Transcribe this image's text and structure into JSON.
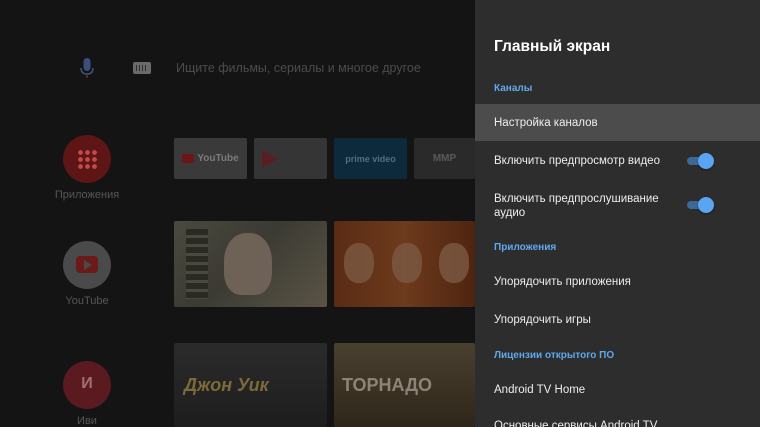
{
  "home": {
    "search_placeholder": "Ищите фильмы, сериалы и многое другое",
    "apps": [
      {
        "label": "Приложения"
      },
      {
        "label": "YouTube"
      },
      {
        "label": "Иви",
        "mark": "И"
      }
    ],
    "channel_tiles": [
      {
        "name": "YouTube",
        "text": "YouTube"
      },
      {
        "name": "Google Play Фильмы",
        "text": ""
      },
      {
        "name": "Prime Video",
        "text": "prime video"
      },
      {
        "name": "MMP",
        "text": "MMP"
      }
    ],
    "movies": [
      {
        "title": "Джон Уик"
      },
      {
        "title": "ТОРНАДО"
      }
    ]
  },
  "panel": {
    "title": "Главный экран",
    "sections": {
      "channels": "Каналы",
      "apps": "Приложения",
      "licenses": "Лицензии открытого ПО"
    },
    "items": {
      "channel_setup": "Настройка каналов",
      "video_preview": "Включить предпросмотр видео",
      "audio_preview": "Включить предпрослушивание аудио",
      "sort_apps": "Упорядочить приложения",
      "sort_games": "Упорядочить игры",
      "android_tv_home": "Android TV Home",
      "core_services": "Основные сервисы Android TV"
    },
    "toggles": {
      "video_preview_on": true,
      "audio_preview_on": true
    }
  },
  "colors": {
    "panel_bg": "#2d2d2d",
    "focused_item_bg": "#4c4c4c",
    "section_header": "#5fa8ee",
    "toggle_on": "#5aa5f2"
  },
  "icons": [
    "microphone-icon",
    "keyboard-icon",
    "apps-grid-icon",
    "youtube-play-icon",
    "ivi-logo-icon"
  ]
}
